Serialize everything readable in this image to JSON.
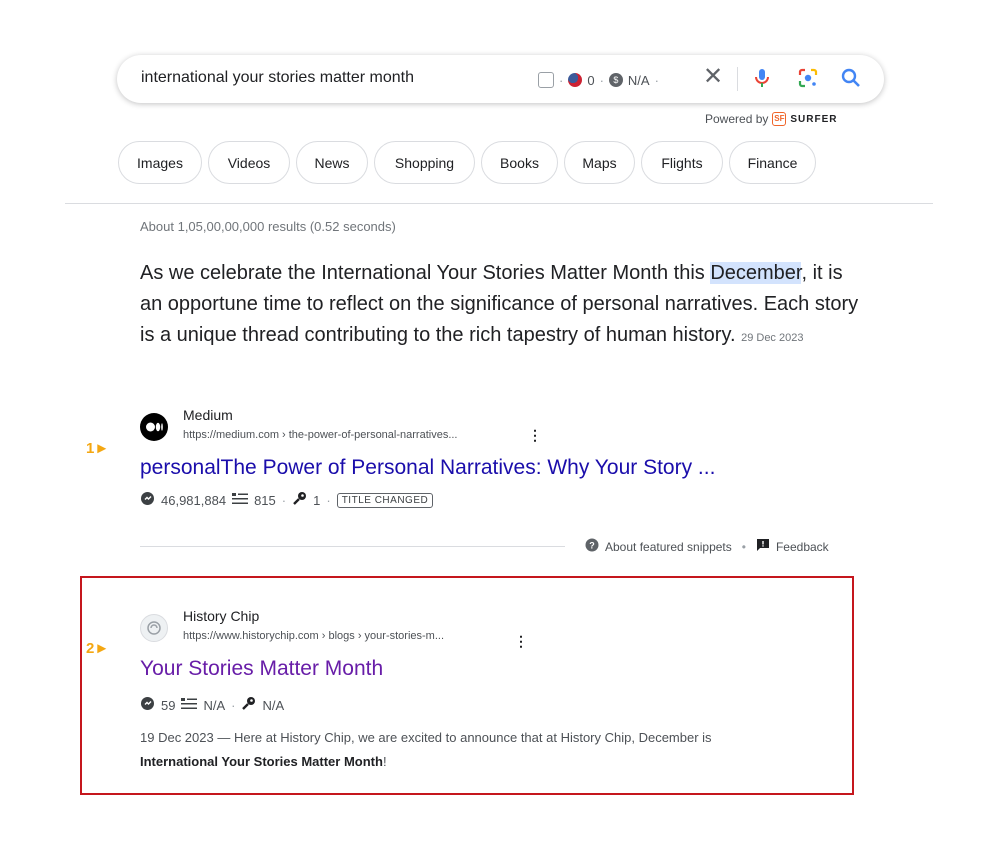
{
  "search": {
    "query": "international your stories matter month",
    "surfer_count": "0",
    "surfer_value": "N/A",
    "powered_by": "Powered by",
    "powered_brand": "SURFER"
  },
  "chips": [
    "Images",
    "Videos",
    "News",
    "Shopping",
    "Books",
    "Maps",
    "Flights",
    "Finance"
  ],
  "results_stats": "About 1,05,00,00,000 results (0.52 seconds)",
  "featured": {
    "text_before": "As we celebrate the International Your Stories Matter Month this ",
    "highlight": "December",
    "text_after": ", it is an opportune time to reflect on the significance of personal narratives. Each story is a unique thread contributing to the rich tapestry of human history. ",
    "date": "29 Dec 2023"
  },
  "result1": {
    "marker": "1",
    "site_name": "Medium",
    "url": "https://medium.com › the-power-of-personal-narratives...",
    "title": "personalThe Power of Personal Narratives: Why Your Story ...",
    "metric1": "46,981,884",
    "metric2": "815",
    "metric3": "1",
    "badge": "TITLE CHANGED"
  },
  "feedback": {
    "about": "About featured snippets",
    "feedback": "Feedback"
  },
  "result2": {
    "marker": "2",
    "site_name": "History Chip",
    "url": "https://www.historychip.com › blogs › your-stories-m...",
    "title": "Your Stories Matter Month",
    "metric1": "59",
    "metric2": "N/A",
    "metric3": "N/A",
    "desc_before": "19 Dec 2023 — Here at History Chip, we are excited to announce that at History Chip, December is ",
    "desc_bold": "International Your Stories Matter Month",
    "desc_after": "!"
  },
  "colors": {
    "link": "#1a0dab",
    "visited": "#681da8",
    "marker": "#f4a712",
    "highlight_box": "#c5161d"
  }
}
